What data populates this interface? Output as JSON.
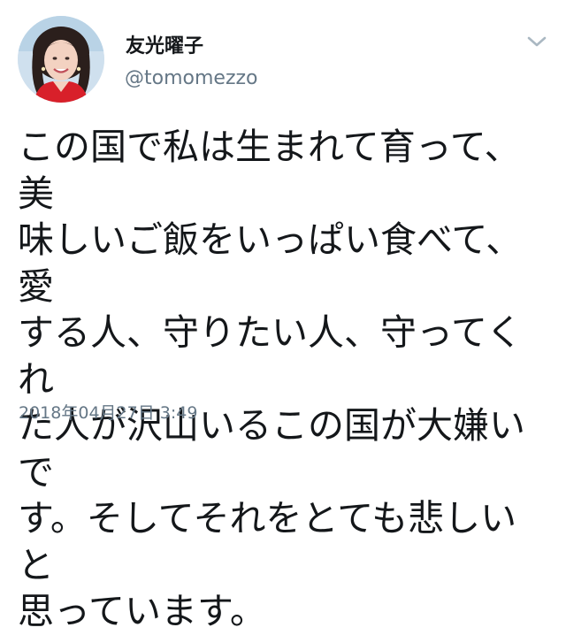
{
  "tweet": {
    "display_name": "友光曜子",
    "handle": "@tomomezzo",
    "text": "この国で私は生まれて育って、美\n味しいご飯をいっぱい食べて、愛\nする人、守りたい人、守ってくれ\nた人が沢山いるこの国が大嫌いで\nす。そしてそれをとても悲しいと\n思っています。",
    "timestamp": "2018年04月27日 3:49"
  },
  "icons": {
    "avatar": "profile-photo",
    "menu": "chevron-down-icon"
  },
  "colors": {
    "text": "#14171a",
    "secondary": "#657786",
    "caret": "#aab8c2",
    "background": "#ffffff"
  }
}
